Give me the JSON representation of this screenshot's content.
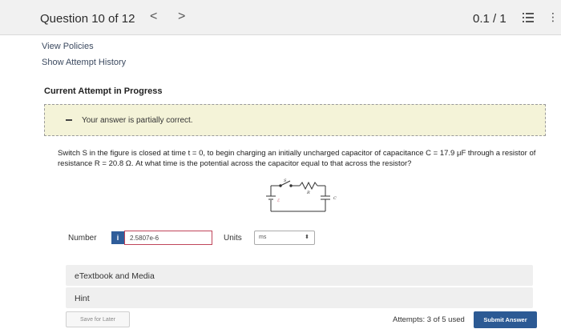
{
  "header": {
    "question_title": "Question 10 of 12",
    "prev_glyph": "<",
    "next_glyph": ">",
    "score": "0.1 / 1",
    "more_glyph": "⋮"
  },
  "links": {
    "view_policies": "View Policies",
    "show_attempt_history": "Show Attempt History"
  },
  "attempt_heading": "Current Attempt in Progress",
  "feedback": {
    "message": "Your answer is partially correct."
  },
  "question": {
    "text": "Switch S in the figure is closed at time t = 0, to begin charging an initially uncharged capacitor of capacitance C = 17.9 μF through a resistor of resistance R = 20.8 Ω. At what time is the potential across the capacitor equal to that across the resistor?"
  },
  "circuit_labels": {
    "switch": "S",
    "resistor": "R",
    "capacitor": "C",
    "battery": "ℰ"
  },
  "answer": {
    "number_label": "Number",
    "info_badge": "i",
    "value": "2.5807e-6",
    "units_label": "Units",
    "units_value": "ms",
    "units_arrow": "⬍"
  },
  "panels": {
    "etextbook": "eTextbook and Media",
    "hint": "Hint"
  },
  "footer": {
    "save_for_later": "Save for Later",
    "attempts": "Attempts: 3 of 5 used",
    "submit": "Submit Answer"
  },
  "colors": {
    "submit_bg": "#2c5a94",
    "error_border": "#c0455a",
    "feedback_bg": "#f4f3d8"
  }
}
